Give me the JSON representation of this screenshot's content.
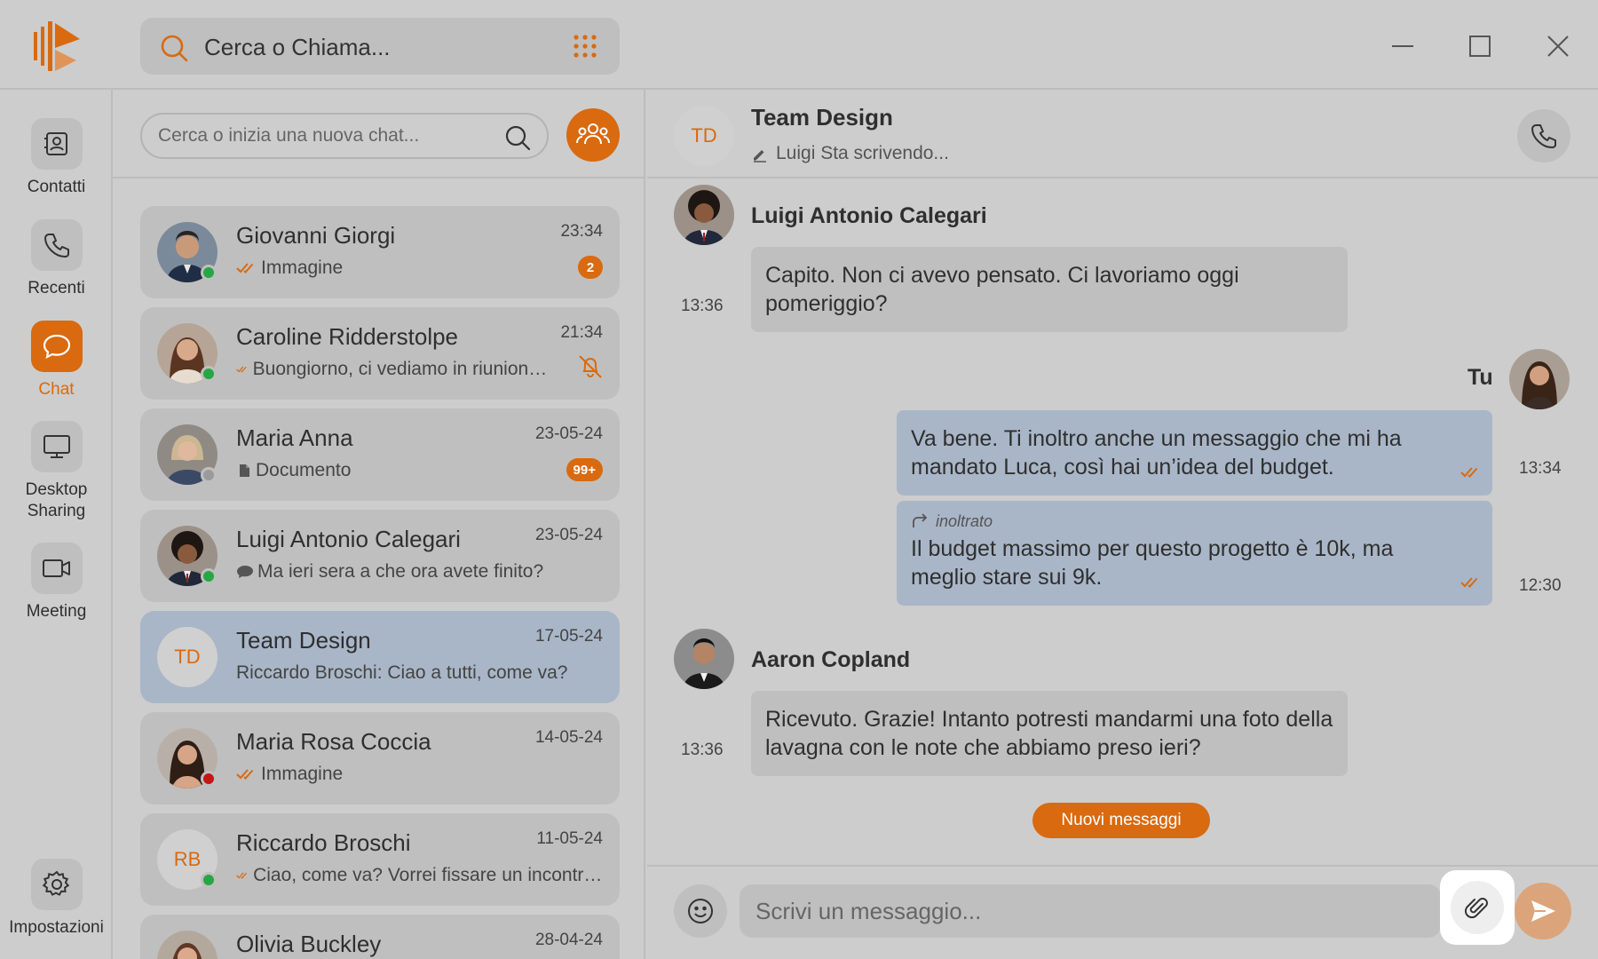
{
  "colors": {
    "accent": "#d96a0f",
    "background": "#cdcdcd",
    "card": "#bfbfbf",
    "selected": "#a9b6c7",
    "online": "#27a644",
    "busy": "#c61515",
    "offline": "#9a9a9a"
  },
  "titlebar": {
    "search_label": "Cerca o Chiama..."
  },
  "rail": [
    {
      "label": "Contatti",
      "icon": "contacts-icon"
    },
    {
      "label": "Recenti",
      "icon": "phone-icon"
    },
    {
      "label": "Chat",
      "icon": "chat-bubble-icon",
      "active": true
    },
    {
      "label": "Desktop Sharing",
      "icon": "monitor-icon"
    },
    {
      "label": "Meeting",
      "icon": "video-camera-icon"
    },
    {
      "label": "Impostazioni",
      "icon": "gear-icon"
    }
  ],
  "chatlist": {
    "search_placeholder": "Cerca o inizia una nuova chat...",
    "chats": [
      {
        "name": "Giovanni Giorgi",
        "time": "23:34",
        "preview": "Immagine",
        "preview_icon": "double-check-icon",
        "badge": "2",
        "presence": "online"
      },
      {
        "name": "Caroline Ridderstolpe",
        "time": "21:34",
        "preview": "Buongiorno, ci vediamo in riunione per discutere il progetto?",
        "preview_icon": "double-check-icon",
        "muted": true,
        "presence": "online"
      },
      {
        "name": "Maria Anna",
        "time": "23-05-24",
        "preview": "Documento",
        "preview_icon": "document-icon",
        "badge": "99+",
        "presence": "offline"
      },
      {
        "name": "Luigi Antonio Calegari",
        "time": "23-05-24",
        "preview": "Ma ieri sera a che ora avete finito?",
        "preview_icon": "chat-bubble-icon",
        "presence": "online"
      },
      {
        "name": "Team Design",
        "initials": "TD",
        "time": "17-05-24",
        "preview": "Riccardo Broschi: Ciao a tutti, come va?",
        "selected": true
      },
      {
        "name": "Maria Rosa Coccia",
        "time": "14-05-24",
        "preview": "Immagine",
        "preview_icon": "double-check-icon",
        "presence": "busy"
      },
      {
        "name": "Riccardo Broschi",
        "initials": "RB",
        "time": "11-05-24",
        "preview": "Ciao, come va? Vorrei fissare un incontro per la prossima settimana",
        "preview_icon": "double-check-icon",
        "presence": "online"
      },
      {
        "name": "Olivia Buckley",
        "time": "28-04-24",
        "preview": ""
      }
    ]
  },
  "conversation": {
    "initials": "TD",
    "title": "Team Design",
    "typing": "Luigi Sta scrivendo...",
    "messages": [
      {
        "sender": "Luigi Antonio Calegari",
        "text": "Capito. Non ci avevo pensato. Ci lavoriamo oggi pomeriggio?",
        "time": "13:36"
      },
      {
        "sender": "Tu",
        "text": "Va bene. Ti inoltro anche un messaggio che mi ha mandato Luca, così hai un’idea del budget.",
        "time": "13:34"
      },
      {
        "forward_label": "inoltrato",
        "text": "Il budget massimo per questo progetto è 10k, ma meglio stare sui 9k.",
        "time": "12:30"
      },
      {
        "sender": "Aaron Copland",
        "text": "Ricevuto. Grazie! Intanto potresti mandarmi una foto della lavagna con le note che abbiamo preso ieri?",
        "time": "13:36"
      }
    ],
    "new_messages_label": "Nuovi messaggi",
    "composer_placeholder": "Scrivi un messaggio..."
  }
}
